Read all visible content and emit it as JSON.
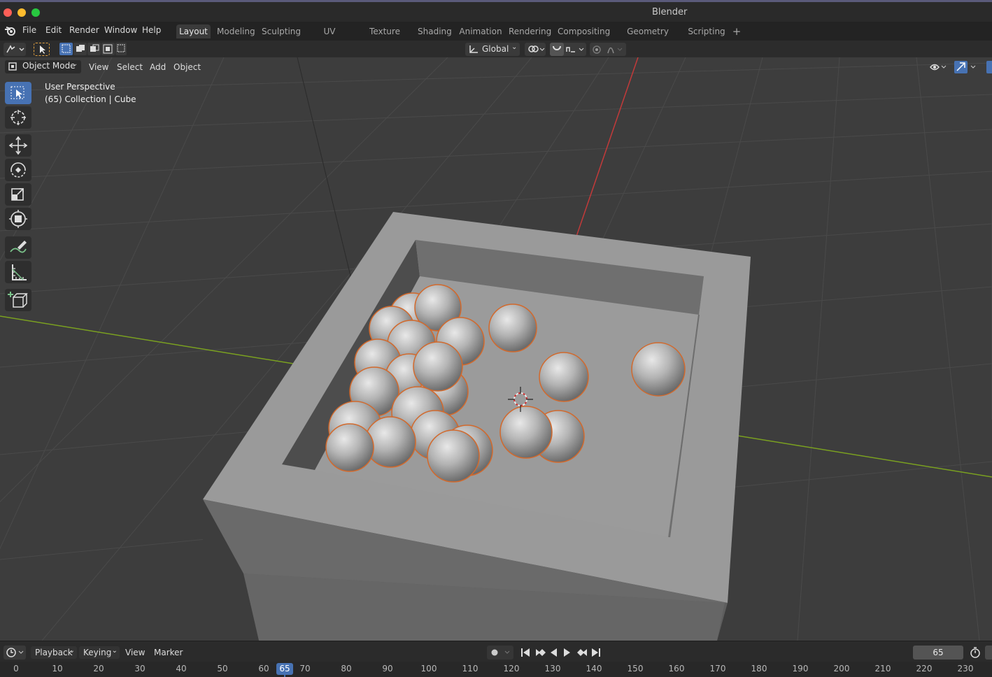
{
  "window": {
    "title": "Blender"
  },
  "menubar": {
    "items": [
      "File",
      "Edit",
      "Render",
      "Window",
      "Help"
    ],
    "workspaces": [
      "Layout",
      "Modeling",
      "Sculpting",
      "UV Editing",
      "Texture Paint",
      "Shading",
      "Animation",
      "Rendering",
      "Compositing",
      "Geometry Nodes",
      "Scripting"
    ],
    "active_workspace": "Layout",
    "add_tab_glyph": "+"
  },
  "header": {
    "transform_orientation": "Global"
  },
  "viewport": {
    "mode": "Object Mode",
    "menus": [
      "View",
      "Select",
      "Add",
      "Object"
    ],
    "overlay_line1": "User Perspective",
    "overlay_line2": "(65) Collection | Cube"
  },
  "timeline": {
    "menus": [
      "Playback",
      "Keying",
      "View",
      "Marker"
    ],
    "current_frame": "65",
    "ticks": [
      "0",
      "10",
      "20",
      "30",
      "40",
      "50",
      "60",
      "70",
      "80",
      "90",
      "100",
      "110",
      "120",
      "130",
      "140",
      "150",
      "160",
      "170",
      "180",
      "190",
      "200",
      "210",
      "220",
      "230"
    ]
  },
  "colors": {
    "accent": "#4772b3",
    "selection_outline": "#e0692a",
    "x_axis": "#c23a3a",
    "y_axis": "#7aa020"
  },
  "icons": [
    "blender-logo-icon",
    "select-box-icon",
    "cursor-icon",
    "move-icon",
    "rotate-icon",
    "scale-icon",
    "transform-icon",
    "annotate-icon",
    "measure-icon",
    "add-cube-icon",
    "play-icon",
    "jump-start-icon",
    "jump-end-icon",
    "prev-keyframe-icon",
    "next-keyframe-icon",
    "play-reverse-icon",
    "record-icon",
    "stopwatch-icon"
  ]
}
